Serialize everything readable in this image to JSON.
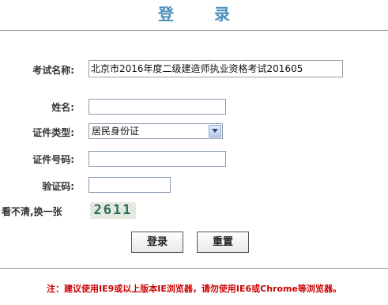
{
  "page": {
    "title": "登 录"
  },
  "form": {
    "exam_label": "考试名称:",
    "exam_value": "北京市2016年度二级建造师执业资格考试201605",
    "name_label": "姓名:",
    "name_value": "",
    "idtype_label": "证件类型:",
    "idtype_value": "居民身份证",
    "idnum_label": "证件号码:",
    "idnum_value": "",
    "captcha_label": "验证码:",
    "captcha_value": "",
    "captcha_image_text": "2611",
    "refresh_text": "看不清,换一张"
  },
  "buttons": {
    "login": "登录",
    "reset": "重置"
  },
  "notice": "注：建议使用IE9或以上版本IE浏览器，请勿使用IE6或Chrome等浏览器。"
}
